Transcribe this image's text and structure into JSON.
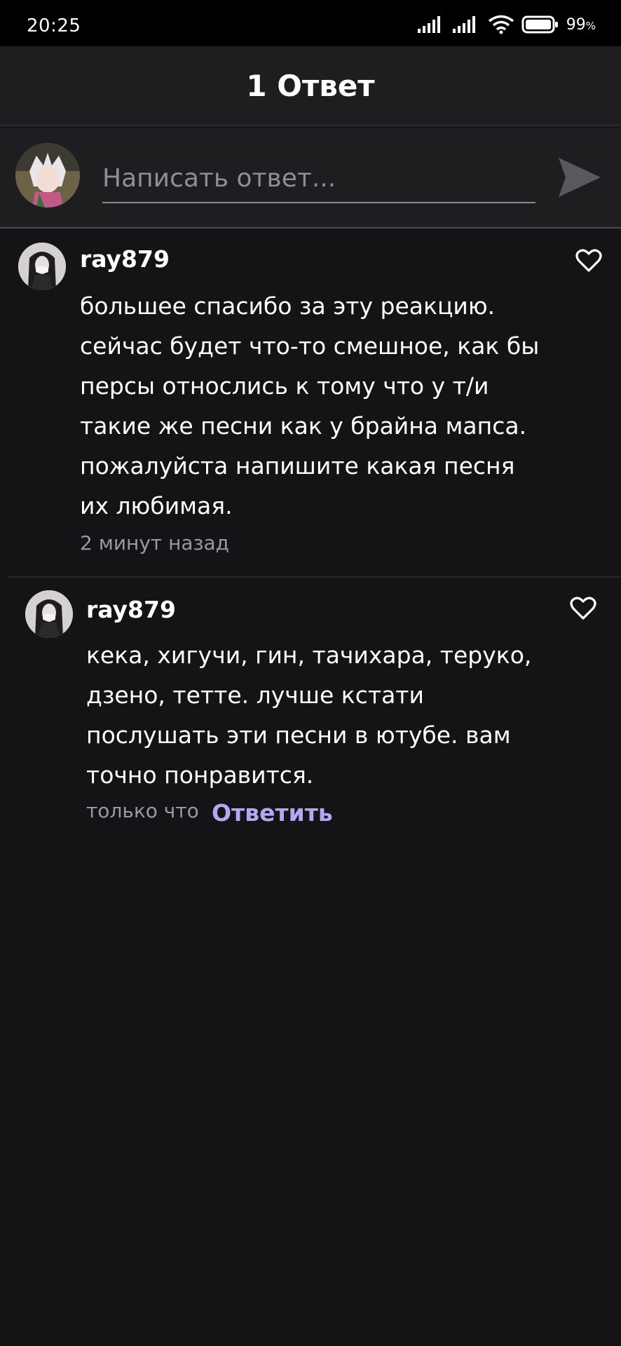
{
  "status_bar": {
    "time": "20:25",
    "battery": "99",
    "battery_unit": "%",
    "icons": [
      "signal-icon",
      "signal-icon",
      "wifi-icon",
      "battery-icon"
    ]
  },
  "header": {
    "title": "1 Ответ"
  },
  "compose": {
    "placeholder": "Написать ответ...",
    "send_icon": "send-icon"
  },
  "comments": [
    {
      "username": "ray879",
      "text_lines": [
        "большее спасибо за эту реакцию.",
        "сейчас будет что-то смешное, как бы",
        "персы относлись к тому что у т/и",
        "такие же песни как у брайна мапса.",
        "пожалуйста напишите какая песня",
        "их любимая."
      ],
      "time": "2 минут назад"
    },
    {
      "username": "ray879",
      "text_lines": [
        "кека, хигучи, гин, тачихара, теруко,",
        "дзено, тетте. лучше кстати",
        "послушать эти песни в ютубе. вам",
        "точно понравится."
      ],
      "time": "только что",
      "reply_label": "Ответить"
    }
  ],
  "colors": {
    "background": "#141316",
    "header": "#1e1d20",
    "accent": "#b5a8f3",
    "muted_text": "#9a999e"
  }
}
